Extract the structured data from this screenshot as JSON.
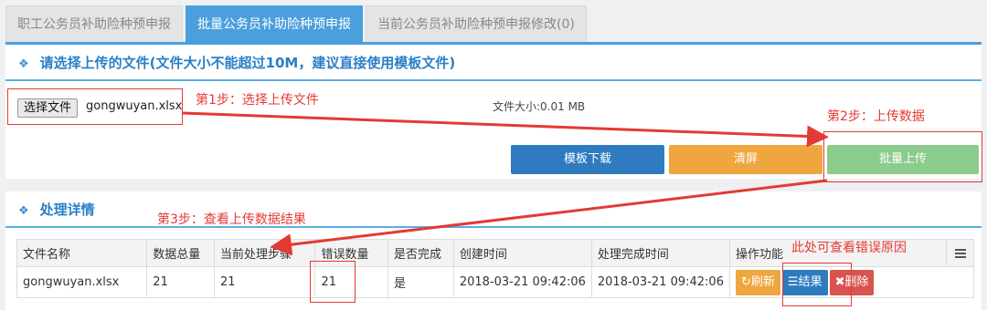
{
  "tabs": [
    {
      "label": "职工公务员补助险种预申报",
      "active": false
    },
    {
      "label": "批量公务员补助险种预申报",
      "active": true
    },
    {
      "label": "当前公务员补助险种预申报修改(0)",
      "active": false
    }
  ],
  "upload_panel": {
    "title": "请选择上传的文件(文件大小不能超过10M，建议直接使用模板文件)",
    "choose_button": "选择文件",
    "file_name": "gongwuyan.xlsx",
    "file_size": "文件大小:0.01 MB",
    "buttons": {
      "template": "模板下载",
      "clear": "清屏",
      "upload": "批量上传"
    }
  },
  "annotations": {
    "step1": "第1步：选择上传文件",
    "step2": "第2步：上传数据",
    "step3": "第3步：查看上传数据结果",
    "error_hint": "此处可查看错误原因"
  },
  "detail_panel": {
    "title": "处理详情",
    "columns": [
      "文件名称",
      "数据总量",
      "当前处理步骤",
      "错误数量",
      "是否完成",
      "创建时间",
      "处理完成时间",
      "操作功能"
    ],
    "rows": [
      {
        "file": "gongwuyan.xlsx",
        "total": "21",
        "step": "21",
        "errors": "21",
        "done": "是",
        "created": "2018-03-21 09:42:06",
        "finished": "2018-03-21 09:42:06",
        "actions": {
          "refresh": "刷新",
          "result": "结果",
          "delete": "删除"
        }
      }
    ]
  },
  "colors": {
    "accent": "#4a9fdc",
    "annotation": "#e53935",
    "template_button": "#2e7bbf",
    "clear_button": "#efa63f",
    "upload_button": "#8bcb8b"
  }
}
